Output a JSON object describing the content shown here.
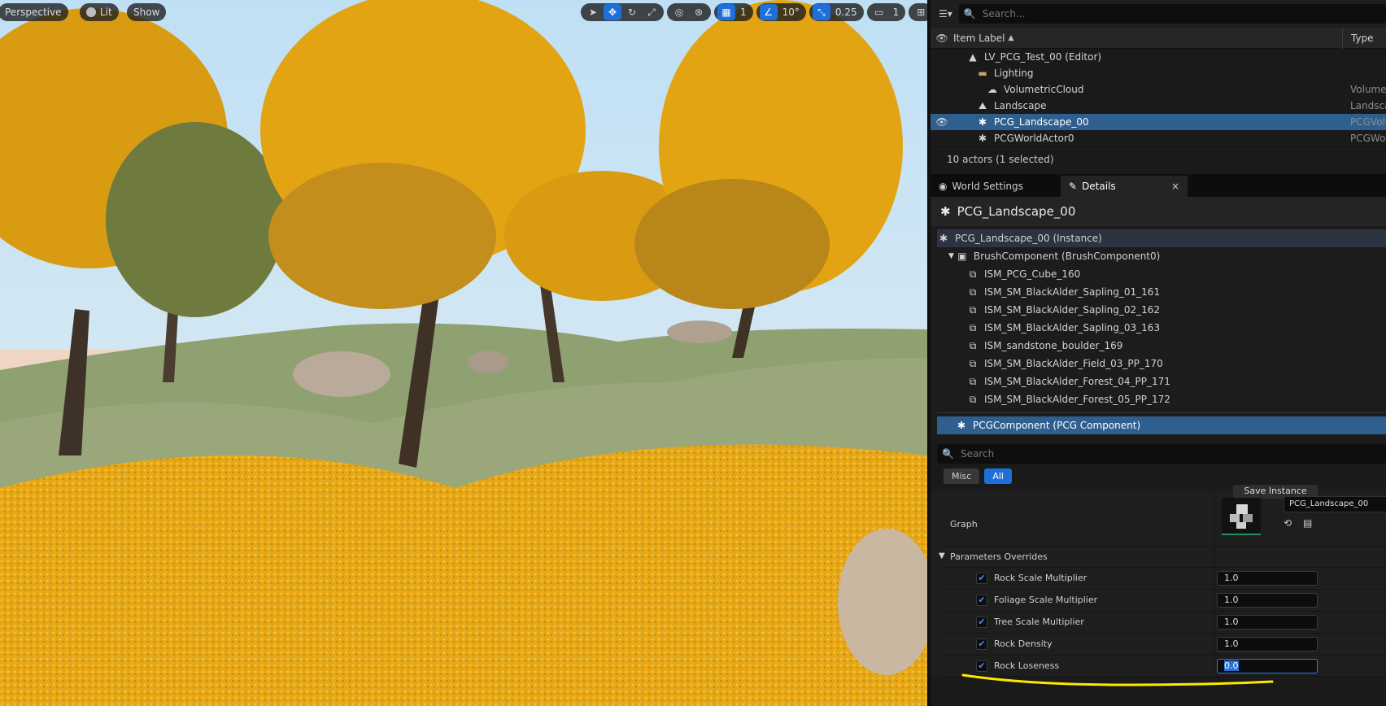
{
  "viewport": {
    "perspective_label": "Perspective",
    "lit_label": "Lit",
    "show_label": "Show",
    "grid_snap_value": "1",
    "rotation_snap_value": "10°",
    "scale_snap_value": "0.25",
    "camera_speed_value": "1",
    "accent_color": "#1e6fd9"
  },
  "outliner": {
    "search_placeholder": "Search...",
    "header_label": "Item Label",
    "header_type": "Type",
    "rows": [
      {
        "label": "LV_PCG_Test_00 (Editor)",
        "type": "",
        "icon": "level-icon"
      },
      {
        "label": "Lighting",
        "type": "",
        "icon": "folder-icon"
      },
      {
        "label": "VolumetricCloud",
        "type": "Volumet",
        "icon": "cloud-icon"
      },
      {
        "label": "Landscape",
        "type": "Landsca",
        "icon": "landscape-icon"
      },
      {
        "label": "PCG_Landscape_00",
        "type": "PCGVolu",
        "icon": "pcg-icon"
      },
      {
        "label": "PCGWorldActor0",
        "type": "PCGWor",
        "icon": "pcg-icon"
      }
    ],
    "count_text": "10 actors (1 selected)"
  },
  "tabs": {
    "world_settings": "World Settings",
    "details": "Details",
    "close": "×"
  },
  "details": {
    "title": "PCG_Landscape_00",
    "instance_label": "PCG_Landscape_00 (Instance)",
    "brush_label": "BrushComponent (BrushComponent0)",
    "components": [
      "ISM_PCG_Cube_160",
      "ISM_SM_BlackAlder_Sapling_01_161",
      "ISM_SM_BlackAlder_Sapling_02_162",
      "ISM_SM_BlackAlder_Sapling_03_163",
      "ISM_sandstone_boulder_169",
      "ISM_SM_BlackAlder_Field_03_PP_170",
      "ISM_SM_BlackAlder_Forest_04_PP_171",
      "ISM_SM_BlackAlder_Forest_05_PP_172"
    ],
    "pcg_component_label": "PCGComponent (PCG Component)",
    "search_placeholder": "Search",
    "filter_misc": "Misc",
    "filter_all": "All",
    "save_instance": "Save Instance",
    "graph_label": "Graph",
    "graph_value": "PCG_Landscape_00",
    "overrides_label": "Parameters Overrides",
    "params": [
      {
        "name": "Rock Scale Multiplier",
        "value": "1.0"
      },
      {
        "name": "Foliage Scale Multiplier",
        "value": "1.0"
      },
      {
        "name": "Tree Scale Multiplier",
        "value": "1.0"
      },
      {
        "name": "Rock Density",
        "value": "1.0"
      },
      {
        "name": "Rock Loseness",
        "value": "0.0"
      }
    ]
  }
}
